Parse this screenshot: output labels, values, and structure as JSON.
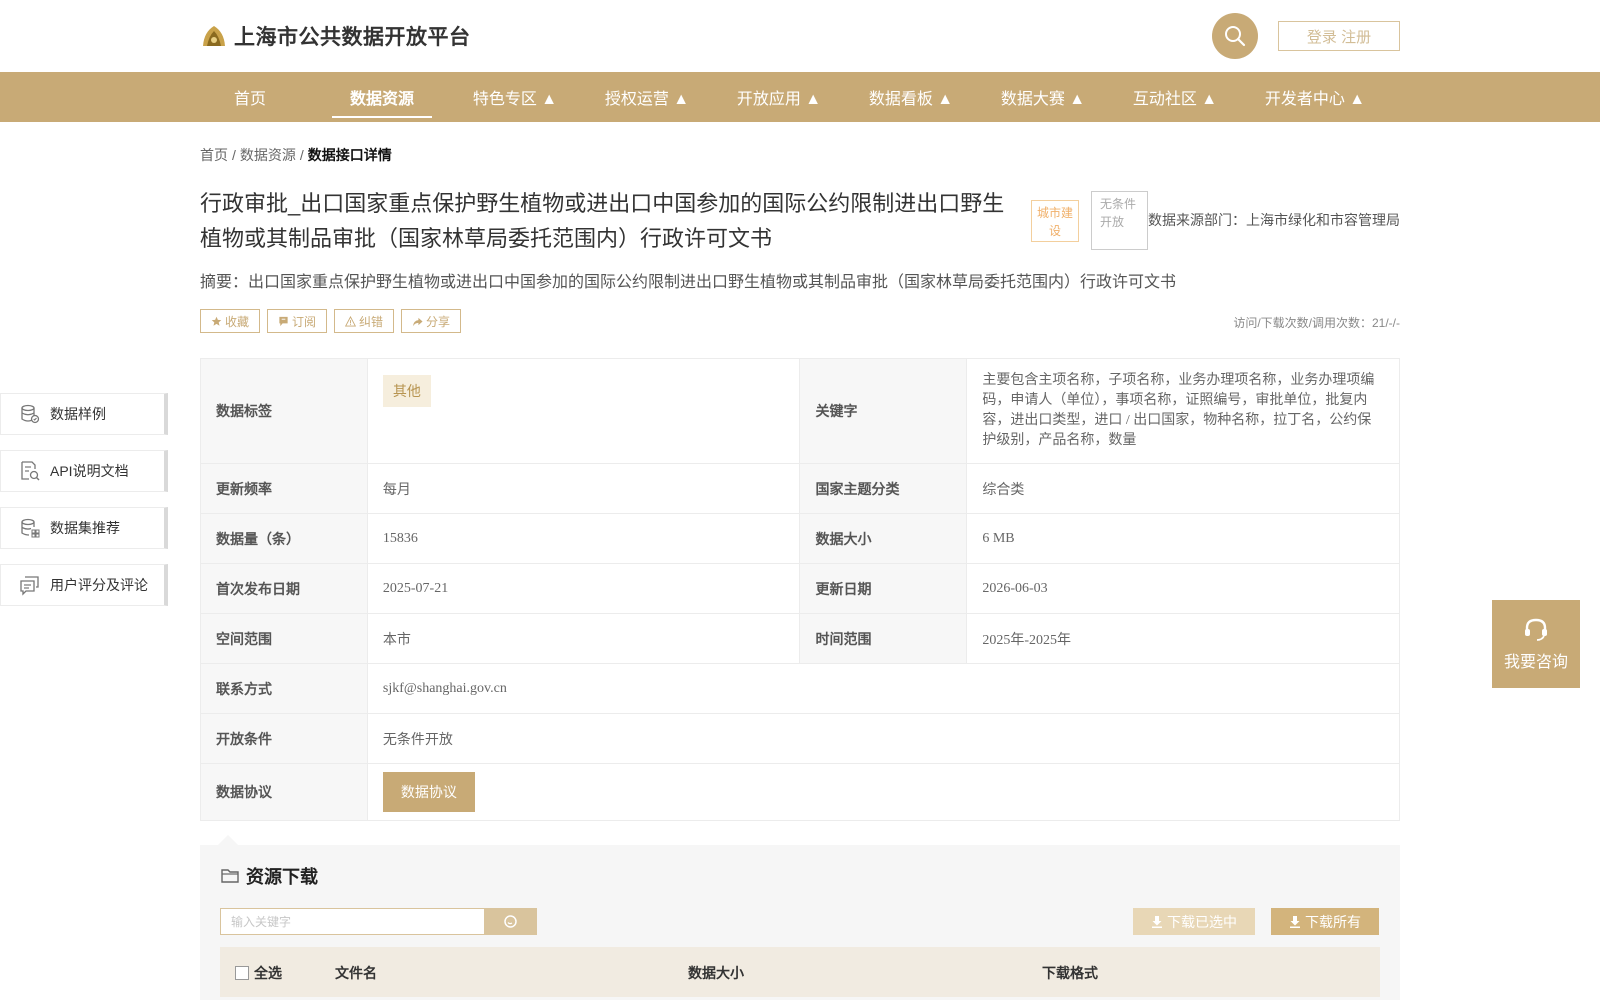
{
  "header": {
    "site_title": "上海市公共数据开放平台",
    "login_label": "登录 注册"
  },
  "nav": {
    "items": [
      {
        "label": "首页"
      },
      {
        "label": "数据资源"
      },
      {
        "label": "特色专区 ▲"
      },
      {
        "label": "授权运营 ▲"
      },
      {
        "label": "开放应用 ▲"
      },
      {
        "label": "数据看板 ▲"
      },
      {
        "label": "数据大赛 ▲"
      },
      {
        "label": "互动社区 ▲"
      },
      {
        "label": "开发者中心 ▲"
      }
    ],
    "active_index": 1
  },
  "breadcrumb": {
    "home": "首页",
    "section": "数据资源",
    "current": "数据接口详情",
    "separator": "/"
  },
  "detail": {
    "title": "行政审批_出口国家重点保护野生植物或进出口中国参加的国际公约限制进出口野生植物或其制品审批（国家林草局委托范围内）行政许可文书",
    "tag_category": "城市建设",
    "tag_open": "无条件开放",
    "source_dept": "数据来源部门：上海市绿化和市容管理局",
    "abstract": "摘要：出口国家重点保护野生植物或进出口中国参加的国际公约限制进出口野生植物或其制品审批（国家林草局委托范围内）行政许可文书",
    "actions": {
      "favorite": "收藏",
      "subscribe": "订阅",
      "report": "纠错",
      "share": "分享"
    },
    "visits": "访问/下载次数/调用次数：21/-/-"
  },
  "side_menu": {
    "items": [
      {
        "label": "数据样例",
        "icon": "database-icon"
      },
      {
        "label": "API说明文档",
        "icon": "doc-search-icon"
      },
      {
        "label": "数据集推荐",
        "icon": "database-grid-icon"
      },
      {
        "label": "用户评分及评论",
        "icon": "comment-icon"
      }
    ]
  },
  "info": {
    "data_tag_label": "数据标签",
    "data_tag_value": "其他",
    "keyword_label": "关键字",
    "keyword_value": "主要包含主项名称，子项名称，业务办理项名称，业务办理项编码，申请人（单位），事项名称，证照编号，审批单位，批复内容，进出口类型，进口 / 出口国家，物种名称，拉丁名，公约保护级别，产品名称，数量",
    "freq_label": "更新频率",
    "freq_value": "每月",
    "theme_label": "国家主题分类",
    "theme_value": "综合类",
    "count_label": "数据量（条）",
    "count_value": "15836",
    "size_label": "数据大小",
    "size_value": "6 MB",
    "first_pub_label": "首次发布日期",
    "first_pub_value": "2025-07-21",
    "update_label": "更新日期",
    "update_value": "2026-06-03",
    "space_label": "空间范围",
    "space_value": "本市",
    "time_label": "时间范围",
    "time_value": "2025年-2025年",
    "contact_label": "联系方式",
    "contact_value": "sjkf@shanghai.gov.cn",
    "open_cond_label": "开放条件",
    "open_cond_value": "无条件开放",
    "agreement_label": "数据协议",
    "agreement_button": "数据协议"
  },
  "download": {
    "title": "资源下载",
    "search_placeholder": "输入关键字",
    "download_selected": "下载已选中",
    "download_all": "下载所有",
    "columns": {
      "select_all": "全选",
      "filename": "文件名",
      "size": "数据大小",
      "format": "下载格式"
    }
  },
  "consult": {
    "label": "我要咨询"
  },
  "colors": {
    "brand_gold": "#c8aa76",
    "light_gold": "#d9c49d",
    "tag_orange": "#f0b06a"
  }
}
